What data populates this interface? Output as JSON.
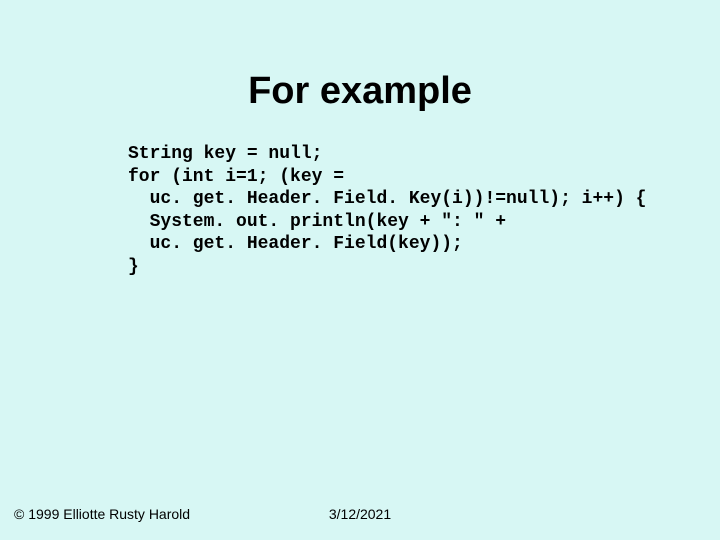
{
  "title": "For example",
  "code": "String key = null;\nfor (int i=1; (key =\n  uc. get. Header. Field. Key(i))!=null); i++) {\n  System. out. println(key + \": \" +\n  uc. get. Header. Field(key));\n}",
  "footer": {
    "copyright": "© 1999 Elliotte Rusty Harold",
    "date": "3/12/2021"
  }
}
